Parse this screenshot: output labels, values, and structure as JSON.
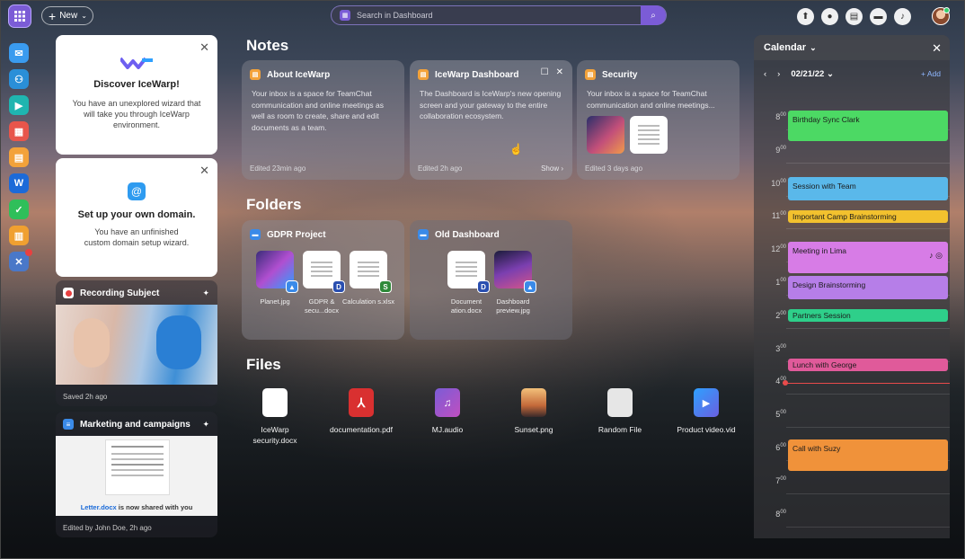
{
  "topbar": {
    "new_label": "New",
    "search_placeholder": "Search in Dashboard",
    "icons": [
      "upload-icon",
      "chat-icon",
      "calendar-icon",
      "message-icon",
      "bell-icon"
    ]
  },
  "sidebar": {
    "apps": [
      {
        "name": "mail",
        "color": "#3a9bef"
      },
      {
        "name": "contacts",
        "color": "#2a8fd8"
      },
      {
        "name": "meetings",
        "color": "#1fb5b0"
      },
      {
        "name": "calendar",
        "color": "#e8554b"
      },
      {
        "name": "notes",
        "color": "#f3a23a"
      },
      {
        "name": "files",
        "color": "#1c6ad8"
      },
      {
        "name": "tasks",
        "color": "#2fbf5a"
      },
      {
        "name": "documents",
        "color": "#f0a030"
      },
      {
        "name": "tools",
        "color": "#4a78c8"
      }
    ]
  },
  "left": {
    "discover": {
      "title": "Discover IceWarp!",
      "text": "You have an unexplored wizard that will take you through IceWarp environment."
    },
    "domain": {
      "title": "Set up your own domain.",
      "text": "You have an unfinished custom domain setup wizard."
    },
    "recording": {
      "title": "Recording Subject",
      "footer": "Saved 2h ago"
    },
    "marketing": {
      "title": "Marketing and campaigns",
      "shared_file": "Letter.docx",
      "shared_rest": " is now shared with you",
      "footer": "Edited by John Doe, 2h ago"
    }
  },
  "notes": {
    "title": "Notes",
    "cards": [
      {
        "title": "About IceWarp",
        "text": "Your inbox is a space for TeamChat communication and online meetings as well as room to create, share and edit documents as a team.",
        "footer": "Edited 23min ago"
      },
      {
        "title": "IceWarp Dashboard",
        "text": "The Dashboard is IceWarp's new opening screen and your gateway to the entire collaboration ecosystem.",
        "footer": "Edited 2h ago",
        "show": "Show"
      },
      {
        "title": "Security",
        "text": "Your inbox is a space for TeamChat communication and online meetings...",
        "footer": "Edited 3 days ago"
      }
    ]
  },
  "folders": {
    "title": "Folders",
    "cards": [
      {
        "title": "GDPR Project",
        "files": [
          "Planet.jpg",
          "GDPR & secu...docx",
          "Calculation s.xlsx"
        ]
      },
      {
        "title": "Old Dashboard",
        "files": [
          "Document ation.docx",
          "Dashboard preview.jpg"
        ]
      }
    ]
  },
  "files": {
    "title": "Files",
    "items": [
      {
        "name": "IceWarp security.docx",
        "icon": "docx-icon"
      },
      {
        "name": "documentation.pdf",
        "icon": "pdf-icon"
      },
      {
        "name": "MJ.audio",
        "icon": "audio-icon"
      },
      {
        "name": "Sunset.png",
        "icon": "image-icon"
      },
      {
        "name": "Random File",
        "icon": "file-icon"
      },
      {
        "name": "Product video.vid",
        "icon": "video-icon"
      }
    ]
  },
  "calendar": {
    "title": "Calendar",
    "date": "02/21/22",
    "add_label": "+ Add",
    "hours": [
      {
        "h": "8",
        "m": "00"
      },
      {
        "h": "9",
        "m": "00"
      },
      {
        "h": "10",
        "m": "00"
      },
      {
        "h": "11",
        "m": "00"
      },
      {
        "h": "12",
        "m": "00"
      },
      {
        "h": "1",
        "m": "00"
      },
      {
        "h": "2",
        "m": "00"
      },
      {
        "h": "3",
        "m": "00"
      },
      {
        "h": "4",
        "m": "00"
      },
      {
        "h": "5",
        "m": "00"
      },
      {
        "h": "6",
        "m": "00"
      },
      {
        "h": "7",
        "m": "00"
      },
      {
        "h": "8",
        "m": "00"
      }
    ],
    "events": [
      {
        "title": "Birthday Sync Clark",
        "color": "#4cd964"
      },
      {
        "title": "Session with Team",
        "color": "#5ab8ea"
      },
      {
        "title": "Important Camp Brainstorming",
        "color": "#f2c12e"
      },
      {
        "title": "Meeting in Lima",
        "color": "#d77ce6"
      },
      {
        "title": "Design Brainstorming",
        "color": "#b67ee8"
      },
      {
        "title": "Partners Session",
        "color": "#2ecf8a"
      },
      {
        "title": "Lunch with George",
        "color": "#e05a9a"
      },
      {
        "title": "Call with Suzy",
        "color": "#f0923a"
      }
    ]
  }
}
